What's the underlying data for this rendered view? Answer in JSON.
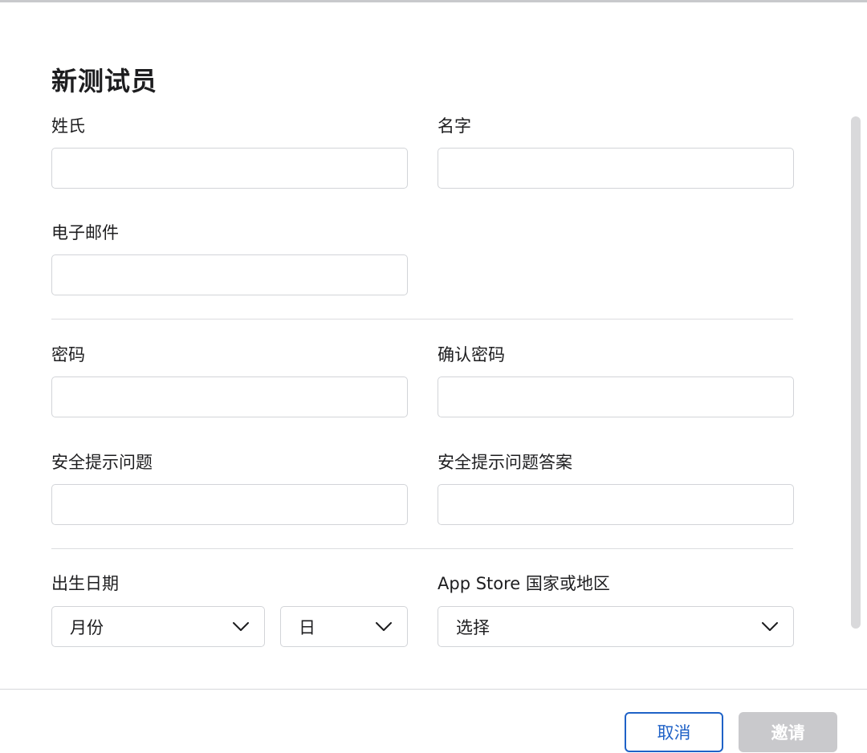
{
  "dialog": {
    "title": "新测试员"
  },
  "fields": {
    "last_name": {
      "label": "姓氏",
      "value": ""
    },
    "first_name": {
      "label": "名字",
      "value": ""
    },
    "email": {
      "label": "电子邮件",
      "value": ""
    },
    "password": {
      "label": "密码",
      "value": ""
    },
    "confirm_password": {
      "label": "确认密码",
      "value": ""
    },
    "security_question": {
      "label": "安全提示问题",
      "value": ""
    },
    "security_answer": {
      "label": "安全提示问题答案",
      "value": ""
    }
  },
  "birth_date": {
    "label": "出生日期",
    "month_selected": "月份",
    "day_selected": "日"
  },
  "app_store": {
    "label": "App Store 国家或地区",
    "selected": "选择"
  },
  "footer": {
    "cancel_label": "取消",
    "invite_label": "邀请"
  },
  "colors": {
    "accent": "#1f62c7",
    "disabled_button": "#c9c9cc",
    "border": "#d2d4d8"
  },
  "icons": {
    "chevron": "chevron-down-icon"
  }
}
